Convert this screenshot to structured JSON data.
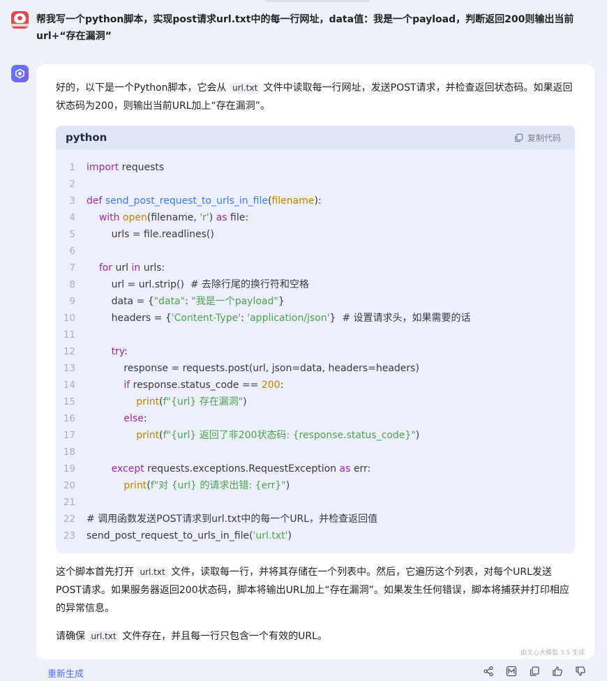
{
  "user_message": {
    "text": "帮我写一个python脚本，实现post请求url.txt中的每一行网址，data值：我是一个payload，判断返回200则输出当前url+“存在漏洞”"
  },
  "assistant": {
    "intro_before": "好的，以下是一个Python脚本，它会从 ",
    "intro_code": "url.txt",
    "intro_after": " 文件中读取每一行网址，发送POST请求，并检查返回状态码。如果返回状态码为200，则输出当前URL加上“存在漏洞”。",
    "code": {
      "language": "python",
      "copy_label": "复制代码",
      "lines": [
        {
          "n": "1",
          "t": "import requests"
        },
        {
          "n": "2",
          "t": ""
        },
        {
          "n": "3",
          "t": "def send_post_request_to_urls_in_file(filename):"
        },
        {
          "n": "4",
          "t": "    with open(filename, 'r') as file:"
        },
        {
          "n": "5",
          "t": "        urls = file.readlines()"
        },
        {
          "n": "6",
          "t": ""
        },
        {
          "n": "7",
          "t": "    for url in urls:"
        },
        {
          "n": "8",
          "t": "        url = url.strip()  # 去除行尾的换行符和空格"
        },
        {
          "n": "9",
          "t": "        data = {\"data\": \"我是一个payload\"}"
        },
        {
          "n": "10",
          "t": "        headers = {'Content-Type': 'application/json'}  # 设置请求头，如果需要的话"
        },
        {
          "n": "11",
          "t": ""
        },
        {
          "n": "12",
          "t": "        try:"
        },
        {
          "n": "13",
          "t": "            response = requests.post(url, json=data, headers=headers)"
        },
        {
          "n": "14",
          "t": "            if response.status_code == 200:"
        },
        {
          "n": "15",
          "t": "                print(f\"{url} 存在漏洞\")"
        },
        {
          "n": "16",
          "t": "            else:"
        },
        {
          "n": "17",
          "t": "                print(f\"{url} 返回了非200状态码: {response.status_code}\")"
        },
        {
          "n": "18",
          "t": ""
        },
        {
          "n": "19",
          "t": "        except requests.exceptions.RequestException as err:"
        },
        {
          "n": "20",
          "t": "            print(f\"对 {url} 的请求出错: {err}\")"
        },
        {
          "n": "21",
          "t": ""
        },
        {
          "n": "22",
          "t": "# 调用函数发送POST请求到url.txt中的每一个URL，并检查返回值"
        },
        {
          "n": "23",
          "t": "send_post_request_to_urls_in_file('url.txt')"
        }
      ]
    },
    "explain_before": "这个脚本首先打开 ",
    "explain_code": "url.txt",
    "explain_after": " 文件，读取每一行，并将其存储在一个列表中。然后，它遍历这个列表，对每个URL发送POST请求。如果服务器返回200状态码，脚本将输出URL加上“存在漏洞”。如果发生任何错误，脚本将捕获并打印相应的异常信息。",
    "note_before": "请确保 ",
    "note_code": "url.txt",
    "note_after": " 文件存在，并且每一行只包含一个有效的URL。",
    "watermark": "由文心大模型 3.5 生成"
  },
  "footer": {
    "regenerate_label": "重新生成",
    "icons": [
      "share-icon",
      "image-icon",
      "copy-icon",
      "thumbs-up-icon",
      "thumbs-down-icon"
    ]
  },
  "colors": {
    "accent": "#4e6ef2",
    "background": "#eef1fa",
    "code_bg": "#ecf0fb"
  }
}
